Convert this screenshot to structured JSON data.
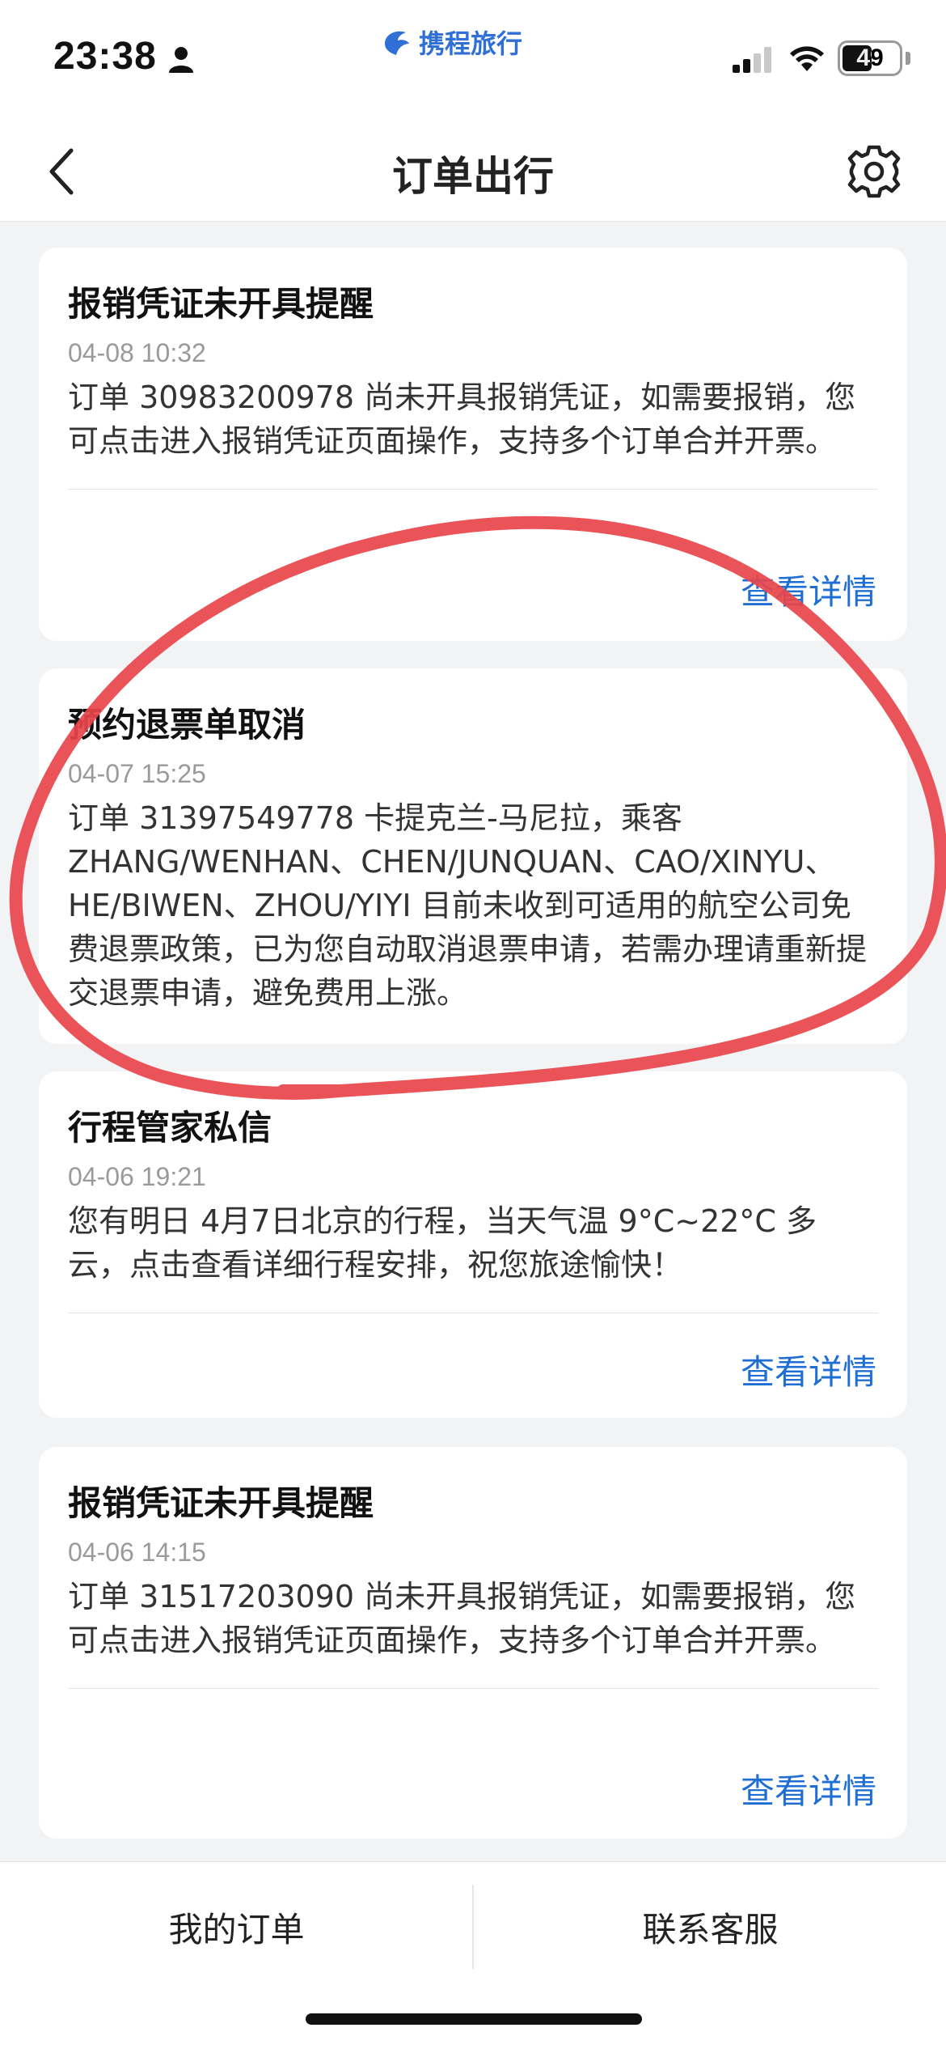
{
  "status_bar": {
    "time": "23:38",
    "battery": "49",
    "icons": [
      "person-icon",
      "signal-icon",
      "wifi-icon",
      "battery-icon"
    ]
  },
  "brand": {
    "name": "携程旅行"
  },
  "nav": {
    "title": "订单出行",
    "back_icon": "chevron-left-icon",
    "settings_icon": "gear-icon"
  },
  "messages": [
    {
      "title": "报销凭证未开具提醒",
      "time": "04-08 10:32",
      "body": "订单 30983200978 尚未开具报销凭证，如需要报销，您可点击进入报销凭证页面操作，支持多个订单合并开票。",
      "link": "查看详情"
    },
    {
      "title": "预约退票单取消",
      "time": "04-07 15:25",
      "body": "订单 31397549778 卡提克兰-马尼拉，乘客 ZHANG/WENHAN、CHEN/JUNQUAN、CAO/XINYU、HE/BIWEN、ZHOU/YIYI 目前未收到可适用的航空公司免费退票政策，已为您自动取消退票申请，若需办理请重新提交退票申请，避免费用上涨。"
    },
    {
      "title": "行程管家私信",
      "time": "04-06 19:21",
      "body": "您有明日 4月7日北京的行程，当天气温 9°C~22°C 多云，点击查看详细行程安排，祝您旅途愉快！",
      "link": "查看详情"
    },
    {
      "title": "报销凭证未开具提醒",
      "time": "04-06 14:15",
      "body": "订单 31517203090 尚未开具报销凭证，如需要报销，您可点击进入报销凭证页面操作，支持多个订单合并开票。",
      "link": "查看详情"
    }
  ],
  "bottom_bar": {
    "my_orders": "我的订单",
    "customer_service": "联系客服"
  },
  "colors": {
    "accent": "#1f6ed4",
    "annotation": "#e8454b",
    "background": "#f2f3f5"
  }
}
